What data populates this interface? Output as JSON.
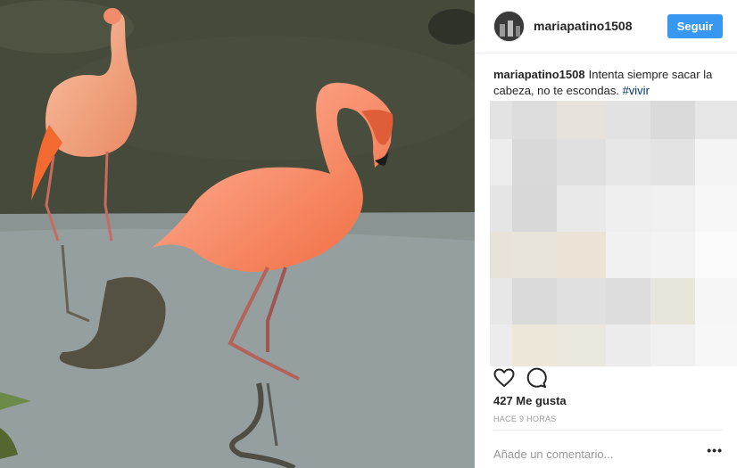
{
  "post": {
    "image_alt": "Flamencos rosados en el agua",
    "username": "mariapatino1508",
    "follow_label": "Seguir",
    "caption_user": "mariapatino1508",
    "caption_text": "Intenta siempre sacar la cabeza, no te escondas.",
    "caption_hashtag": "#vivir",
    "likes": "427 Me gusta",
    "time": "HACE 9 HORAS",
    "comment_placeholder": "Añade un comentario...",
    "more_label": "•••"
  },
  "icons": {
    "like": "heart-icon",
    "comment": "speech-bubble-icon",
    "more": "ellipsis-icon"
  },
  "colors": {
    "follow_button": "#3897f0",
    "hashtag": "#003569",
    "flamingo": "#f47f5b"
  }
}
